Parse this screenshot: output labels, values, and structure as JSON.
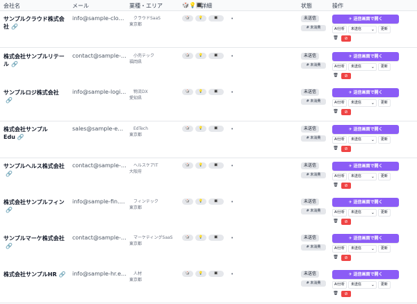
{
  "header": {
    "company": "会社名",
    "email": "メール",
    "industry_area": "業種・エリア",
    "icons": "🎲💡🔳",
    "detail": "詳細",
    "status": "状態",
    "actions": "操作"
  },
  "common": {
    "link_icon": "🔗",
    "send_label": "✈  送信画面で開く",
    "ai_label": "AI分析",
    "select_value": "未送信",
    "update_label": "更新",
    "status_main": "未送信",
    "status_sub": "# 未消費",
    "dot": "•",
    "pill1": "🎲",
    "pill2": "💡",
    "pill3": "🔳",
    "trash": "🗑",
    "del": "⊘",
    "chevron": "⌄"
  },
  "rows": [
    {
      "company": "サンプルクラウド株式会社",
      "email": "info@sample-cloud.jp",
      "industry": "クラウドSaaS",
      "area": "東京都"
    },
    {
      "company": "株式会社サンプルリテール",
      "email": "contact@sample-retail.jp",
      "industry": "小売テック",
      "area": "福岡県"
    },
    {
      "company": "サンプルロジ株式会社",
      "email": "info@sample-logi.jp",
      "industry": "物流DX",
      "area": "愛知県"
    },
    {
      "company": "株式会社サンプルEdu",
      "email": "sales@sample-edu.jp",
      "industry": "EdTech",
      "area": "東京都"
    },
    {
      "company": "サンプルヘルス株式会社",
      "email": "contact@sample-health.jp",
      "industry": "ヘルスケアIT",
      "area": "大阪府"
    },
    {
      "company": "株式会社サンプルフィン",
      "email": "info@sample-fin.example",
      "industry": "フィンテック",
      "area": "東京都"
    },
    {
      "company": "サンプルマーケ株式会社",
      "email": "contact@sample-marke.jp",
      "industry": "マーケティングSaaS",
      "area": "東京都"
    },
    {
      "company": "株式会社サンプルHR",
      "email": "info@sample-hr.example",
      "industry": "人材",
      "area": "東京都"
    }
  ]
}
